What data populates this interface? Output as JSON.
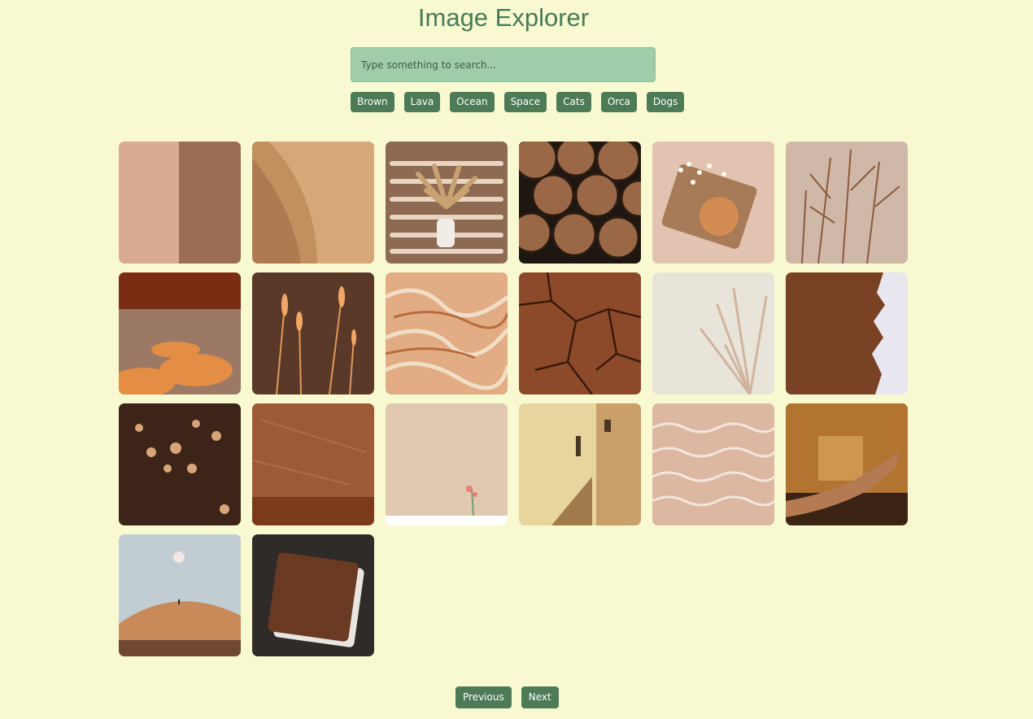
{
  "header": {
    "title": "Image Explorer"
  },
  "search": {
    "placeholder": "Type something to search...",
    "value": ""
  },
  "categories": [
    "Brown",
    "Lava",
    "Ocean",
    "Space",
    "Cats",
    "Orca",
    "Dogs"
  ],
  "colors": {
    "background": "#f9f9d1",
    "accent": "#4d7a57",
    "search_bg": "#a0cda9",
    "title": "#497b5a"
  },
  "images": [
    {
      "name": "wall-split"
    },
    {
      "name": "curved-wall"
    },
    {
      "name": "pampas-vase"
    },
    {
      "name": "stacked-logs"
    },
    {
      "name": "compact-flowers"
    },
    {
      "name": "dried-branches"
    },
    {
      "name": "sunset-clouds"
    },
    {
      "name": "wheat-grass"
    },
    {
      "name": "marble-swirl"
    },
    {
      "name": "cracked-earth"
    },
    {
      "name": "pampas-light"
    },
    {
      "name": "torn-paper"
    },
    {
      "name": "dark-flowers"
    },
    {
      "name": "rust-texture"
    },
    {
      "name": "flower-wall"
    },
    {
      "name": "beige-building"
    },
    {
      "name": "wavy-sand"
    },
    {
      "name": "hand-shadow"
    },
    {
      "name": "desert-moon"
    },
    {
      "name": "old-book"
    }
  ],
  "pagination": {
    "previous_label": "Previous",
    "next_label": "Next"
  }
}
